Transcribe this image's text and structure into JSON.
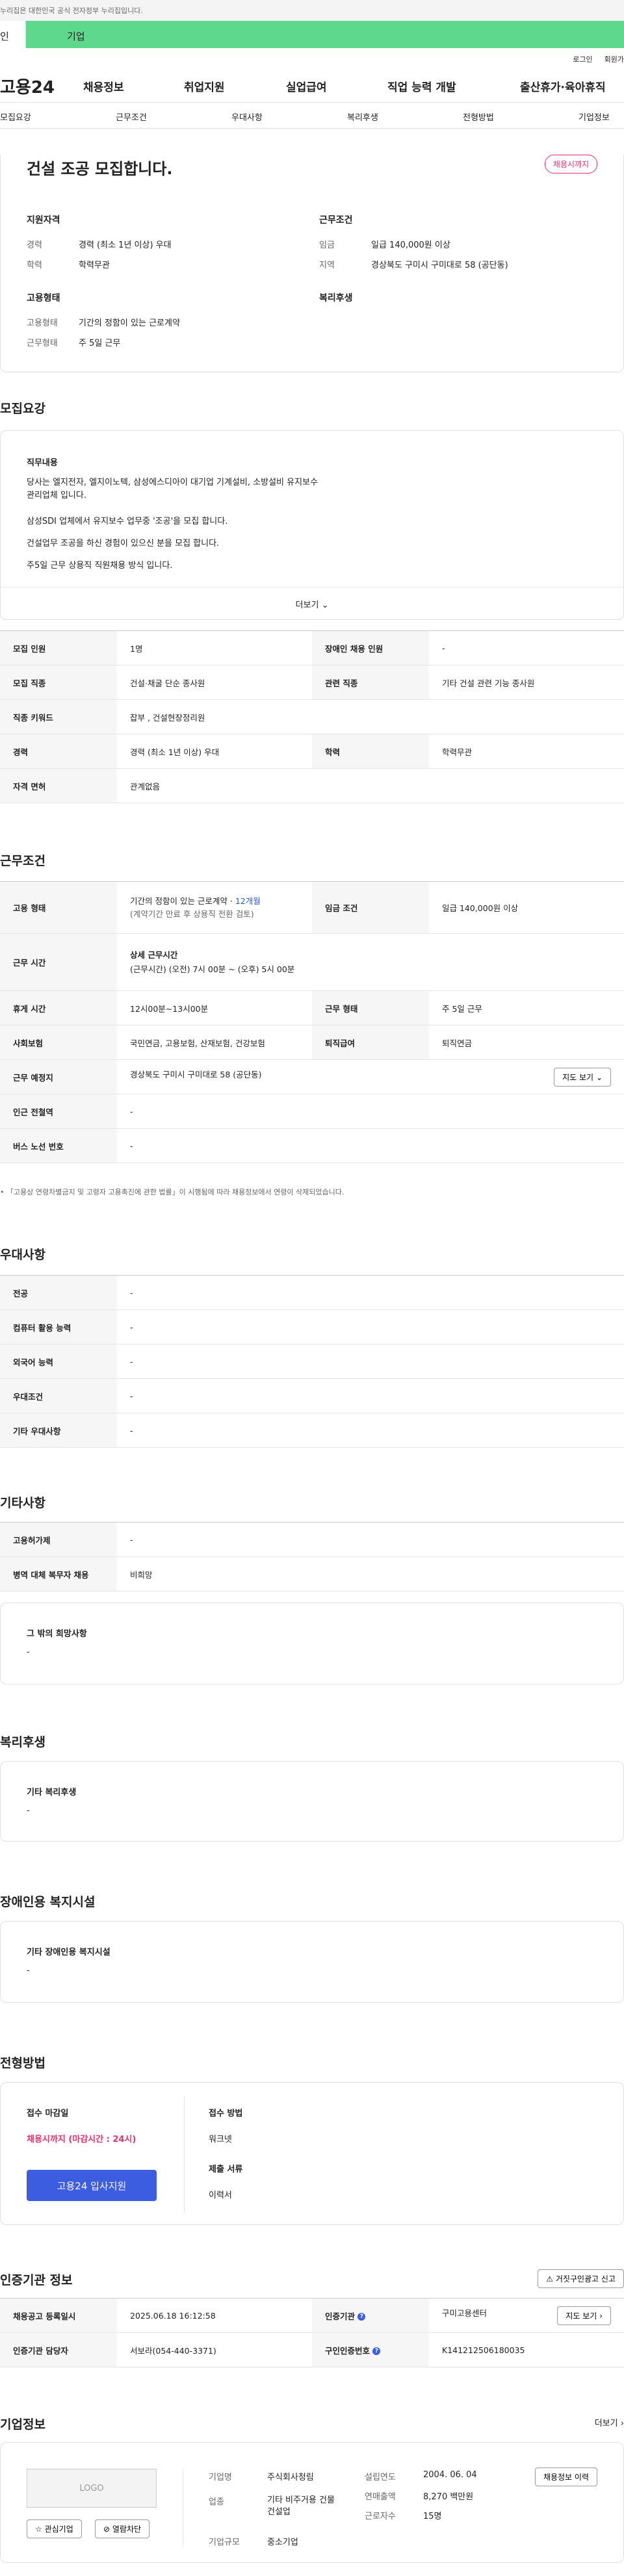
{
  "gov_bar": {
    "text": "누리집은 대한민국 공식 전자정부 누리집입니다."
  },
  "top_tabs": {
    "personal": "인",
    "company": "기업"
  },
  "util": {
    "login": "로그인",
    "signup": "회원가"
  },
  "gnb": {
    "logo": "고용24",
    "menu": [
      "채용정보",
      "취업지원",
      "실업급여",
      "직업 능력 개발",
      "출산휴가·육아휴직"
    ]
  },
  "subnav": [
    "모집요강",
    "근무조건",
    "우대사항",
    "복리후생",
    "전형방법",
    "기업정보"
  ],
  "summary": {
    "title": "건설 조공 모집합니다.",
    "badge": "채용시까지",
    "qualification": {
      "heading": "지원자격",
      "rows": [
        [
          "경력",
          "경력 (최소 1년 이상) 우대"
        ],
        [
          "학력",
          "학력무관"
        ]
      ]
    },
    "conditions": {
      "heading": "근무조건",
      "rows": [
        [
          "임금",
          "일급 140,000원 이상"
        ],
        [
          "지역",
          "경상북도 구미시 구미대로 58 (공단동)"
        ]
      ]
    },
    "employment": {
      "heading": "고용형태",
      "rows": [
        [
          "고용형태",
          "기간의 정함이 있는 근로계약"
        ],
        [
          "근무형태",
          "주 5일 근무"
        ]
      ]
    },
    "welfare": {
      "heading": "복리후생"
    }
  },
  "recruit": {
    "title": "모집요강",
    "job_heading": "직무내용",
    "lines": [
      "당사는 엘지전자, 엘지이노텍, 삼성에스디아이 대기업 기계설비, 소방설비 유지보수",
      "관리업체 입니다.",
      "삼성SDI 업체에서 유지보수 업무중 '조공'을 모집 합니다.",
      "건설업무 조공을 하신 경험이 있으신 분을 모집 합니다.",
      "주5일 근무 상용직 직원채용 방식 입니다."
    ],
    "more": "더보기",
    "table": [
      [
        "모집 인원",
        "1명",
        "장애인 채용 인원",
        "-"
      ],
      [
        "모집 직종",
        "건설·채굴 단순 종사원",
        "관련 직종",
        "기타 건설 관련 기능 종사원"
      ],
      [
        "직종 키워드",
        "잡부 , 건설현장정리원",
        "",
        ""
      ],
      [
        "경력",
        "경력 (최소 1년 이상) 우대",
        "학력",
        "학력무관"
      ],
      [
        "자격 면허",
        "관계없음",
        "",
        ""
      ]
    ]
  },
  "work": {
    "title": "근무조건",
    "employment_label": "고용 형태",
    "employment_value": "기간의 정함이 있는 근로계약 · ",
    "employment_months": "12개월",
    "employment_note": "(계약기간 만료 후 상용직 전환 검토)",
    "wage_label": "임금 조건",
    "wage_value": "일급 140,000원 이상",
    "hours_label": "근무 시간",
    "hours_heading": "상세 근무시간",
    "hours_value": "(근무시간) (오전) 7시 00분 ~ (오후) 5시 00분",
    "rest_label": "휴게 시간",
    "rest_value": "12시00분~13시00분",
    "form_label": "근무 형태",
    "form_value": "주 5일 근무",
    "insurance_label": "사회보험",
    "insurance_value": "국민연금, 고용보험, 산재보험, 건강보험",
    "severance_label": "퇴직급여",
    "severance_value": "퇴직연금",
    "location_label": "근무 예정지",
    "location_value": "경상북도 구미시 구미대로 58 (공단동)",
    "map_button": "지도 보기",
    "subway_label": "인근 전철역",
    "subway_value": "-",
    "bus_label": "버스 노선 번호",
    "bus_value": "-",
    "footnote": "「고용상 연령차별금지 및 고령자 고용촉진에 관한 법률」이 시행됨에 따라 채용정보에서 연령이 삭제되었습니다."
  },
  "preference": {
    "title": "우대사항",
    "rows": [
      [
        "전공",
        "-"
      ],
      [
        "컴퓨터 활용 능력",
        "-"
      ],
      [
        "외국어 능력",
        "-"
      ],
      [
        "우대조건",
        "-"
      ],
      [
        "기타 우대사항",
        "-"
      ]
    ]
  },
  "etc": {
    "title": "기타사항",
    "rows": [
      [
        "고용허가제",
        "-"
      ],
      [
        "병역 대체 복무자 채용",
        "비희망"
      ]
    ],
    "other_heading": "그 밖의 희망사항",
    "other_value": "-"
  },
  "welfare": {
    "title": "복리후생",
    "heading": "기타 복리후생",
    "value": "-"
  },
  "disability": {
    "title": "장애인용 복지시설",
    "heading": "기타 장애인용 복지시설",
    "value": "-"
  },
  "selection": {
    "title": "전형방법",
    "deadline_heading": "접수 마감일",
    "deadline_value": "채용시까지 (마감시간 : 24시)",
    "apply_button": "고용24 입사지원",
    "method_heading": "접수 방법",
    "method_value": "워크넷",
    "docs_heading": "제출 서류",
    "docs_value": "이력서"
  },
  "agency": {
    "title": "인증기관 정보",
    "report_button": "거짓구인광고 신고",
    "reg_label": "채용공고 등록일시",
    "reg_value": "2025.06.18 16:12:58",
    "cert_label": "인증기관",
    "cert_value": "구미고용센터",
    "map_button": "지도 보기",
    "manager_label": "인증기관 담당자",
    "manager_value": "서보라(054-440-3371)",
    "number_label": "구인인증번호",
    "number_value": "K141212506180035"
  },
  "company": {
    "title": "기업정보",
    "more": "더보기",
    "logo": "LOGO",
    "fav_button": "관심기업",
    "block_button": "열람차단",
    "name_label": "기업명",
    "name_value": "주식회사청림",
    "industry_label": "업종",
    "industry_value": "기타 비주거용 건물 건설업",
    "size_label": "기업규모",
    "size_value": "중소기업",
    "founded_label": "설립연도",
    "founded_value": "2004. 06. 04",
    "sales_label": "연매출액",
    "sales_value": "8,270 백만원",
    "workers_label": "근로자수",
    "workers_value": "15명",
    "history_button": "채용정보 이력"
  }
}
